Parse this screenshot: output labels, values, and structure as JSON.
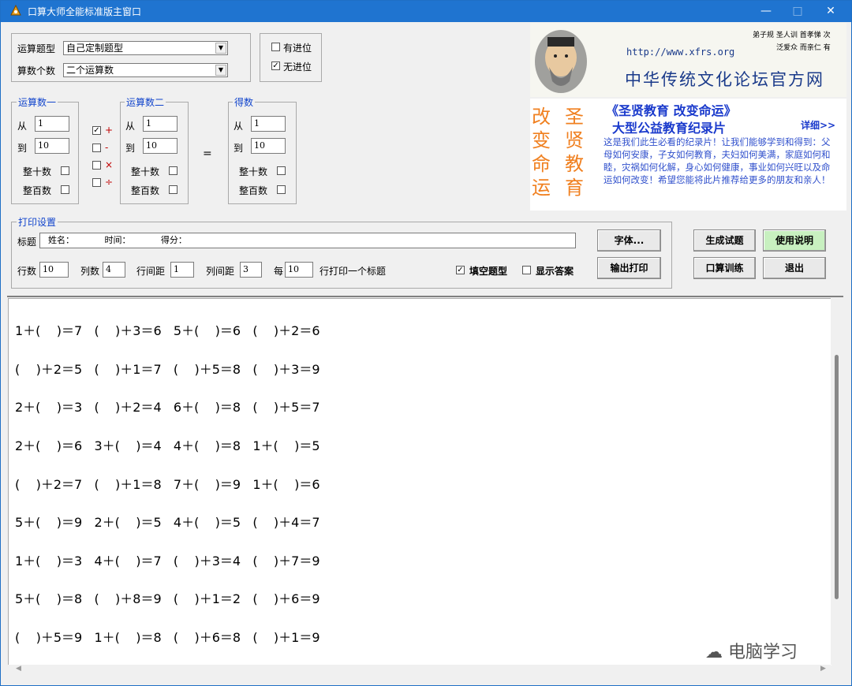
{
  "window": {
    "title": "口算大师全能标准版主窗口",
    "minimize": "—",
    "maximize": "□",
    "close": "✕"
  },
  "settings": {
    "type_label": "运算题型",
    "type_value": "自己定制题型",
    "count_label": "算数个数",
    "count_value": "二个运算数",
    "carry_label": "有进位",
    "carry_checked": false,
    "nocarry_label": "无进位",
    "nocarry_checked": true
  },
  "operand1": {
    "legend": "运算数一",
    "from_label": "从",
    "from_value": "1",
    "to_label": "到",
    "to_value": "10",
    "tens_label": "整十数",
    "hundreds_label": "整百数"
  },
  "operators": [
    {
      "symbol": "+",
      "checked": true
    },
    {
      "symbol": "-",
      "checked": false
    },
    {
      "symbol": "×",
      "checked": false
    },
    {
      "symbol": "÷",
      "checked": false
    }
  ],
  "operand2": {
    "legend": "运算数二",
    "from_label": "从",
    "from_value": "1",
    "to_label": "到",
    "to_value": "10",
    "tens_label": "整十数",
    "hundreds_label": "整百数"
  },
  "equals": "=",
  "result": {
    "legend": "得数",
    "from_label": "从",
    "from_value": "1",
    "to_label": "到",
    "to_value": "10",
    "tens_label": "整十数",
    "hundreds_label": "整百数"
  },
  "banner": {
    "url": "http://www.xfrs.org",
    "title": "中华传统文化论坛官方网",
    "corner1": "弟子规 圣人训 首孝悌 次",
    "corner2": "泛爱众 而亲仁 有"
  },
  "ad": {
    "col1": "改变命运",
    "col2": "圣贤教育",
    "heading": "《圣贤教育 改变命运》",
    "subheading": "大型公益教育纪录片",
    "more": "详细>>",
    "body": "这是我们此生必看的纪录片！让我们能够学到和得到：父母如何安康，子女如何教育，夫妇如何美满，家庭如何和睦，灾祸如何化解，身心如何健康，事业如何兴旺以及命运如何改变！希望您能将此片推荐给更多的朋友和亲人！"
  },
  "print": {
    "legend": "打印设置",
    "title_label": "标题",
    "title_value": "  姓名：           时间：           得分：",
    "rows_label": "行数",
    "rows_value": "10",
    "cols_label": "列数",
    "cols_value": "4",
    "rowgap_label": "行间距",
    "rowgap_value": "1",
    "colgap_label": "列间距",
    "colgap_value": "3",
    "every_label": "每",
    "every_value": "10",
    "every_suffix": "行打印一个标题",
    "fill_label": "填空题型",
    "fill_checked": true,
    "answer_label": "显示答案",
    "answer_checked": false,
    "font_button": "字体...",
    "print_button": "输出打印"
  },
  "actions": {
    "generate": "生成试题",
    "manual": "使用说明",
    "train": "口算训练",
    "exit": "退出"
  },
  "problems": [
    "1＋(    )＝7   (    )＋3＝6   5＋(    )＝6   (    )＋2＝6",
    "(    )＋2＝5   (    )＋1＝7   (    )＋5＝8   (    )＋3＝9",
    "2＋(    )＝3   (    )＋2＝4   6＋(    )＝8   (    )＋5＝7",
    "2＋(    )＝6   3＋(    )＝4   4＋(    )＝8   1＋(    )＝5",
    "(    )＋2＝7   (    )＋1＝8   7＋(    )＝9   1＋(    )＝6",
    "5＋(    )＝9   2＋(    )＝5   4＋(    )＝5   (    )＋4＝7",
    "1＋(    )＝3   4＋(    )＝7   (    )＋3＝4   (    )＋7＝9",
    "5＋(    )＝8   (    )＋8＝9   (    )＋1＝2   (    )＋6＝9",
    "(    )＋5＝9   1＋(    )＝8   (    )＋6＝8   (    )＋1＝9"
  ],
  "watermark": "电脑学习"
}
